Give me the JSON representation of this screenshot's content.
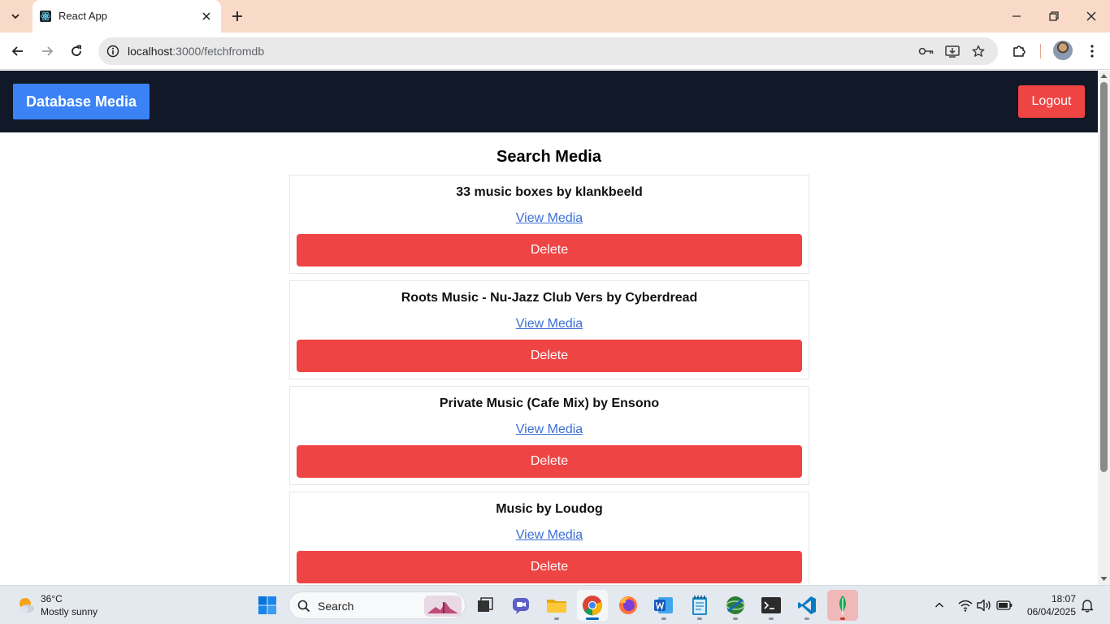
{
  "browser": {
    "tab_title": "React App",
    "url_host": "localhost",
    "url_path": ":3000/fetchfromdb"
  },
  "navbar": {
    "brand": "Database Media",
    "logout_label": "Logout"
  },
  "main": {
    "heading": "Search Media",
    "items": [
      {
        "title": "33 music boxes by klankbeeld",
        "link_label": "View Media",
        "delete_label": "Delete"
      },
      {
        "title": "Roots Music - Nu-Jazz Club Vers by Cyberdread",
        "link_label": "View Media",
        "delete_label": "Delete"
      },
      {
        "title": "Private Music (Cafe Mix) by Ensono",
        "link_label": "View Media",
        "delete_label": "Delete"
      },
      {
        "title": "Music by Loudog",
        "link_label": "View Media",
        "delete_label": "Delete"
      }
    ]
  },
  "taskbar": {
    "weather_temp": "36°C",
    "weather_desc": "Mostly sunny",
    "search_placeholder": "Search",
    "time": "18:07",
    "date": "06/04/2025"
  },
  "colors": {
    "navbar_bg": "#111827",
    "brand_bg": "#3b82f6",
    "danger": "#ef4444",
    "link": "#3b6fd6",
    "tabstrip": "#f9dac9"
  }
}
